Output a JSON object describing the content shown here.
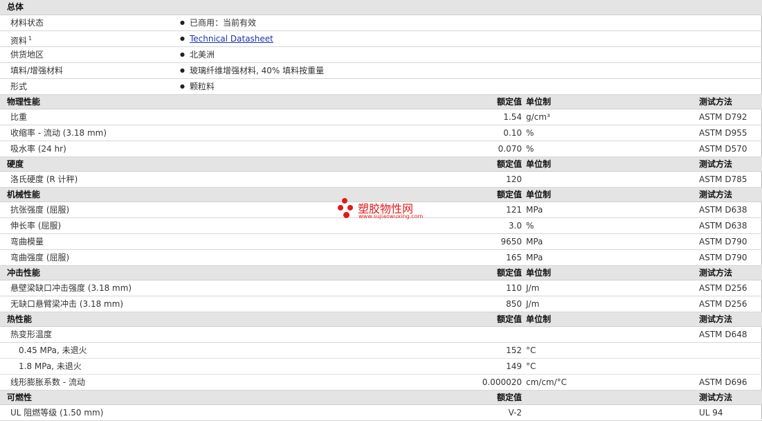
{
  "watermark": {
    "text": "塑胶物性网",
    "url": "www.sujiaowuxing.com",
    "color": "#e01b1b"
  },
  "general": {
    "title": "总体",
    "rows": [
      {
        "label": "材料状态",
        "value": "已商用：当前有效"
      },
      {
        "label": "资料",
        "note": "1",
        "value": "Technical Datasheet",
        "link": true
      },
      {
        "label": "供货地区",
        "value": "北美洲"
      },
      {
        "label": "填料/增强材料",
        "value": "玻璃纤维增强材料, 40% 填料按重量"
      },
      {
        "label": "形式",
        "value": "颗粒料"
      }
    ]
  },
  "sections": [
    {
      "title": "物理性能",
      "h_val": "额定值",
      "h_unit": "单位制",
      "h_test": "测试方法",
      "rows": [
        {
          "label": "比重",
          "value": "1.54",
          "unit": "g/cm³",
          "test": "ASTM D792"
        },
        {
          "label": "收缩率 - 流动  (3.18 mm)",
          "value": "0.10",
          "unit": "%",
          "test": "ASTM D955"
        },
        {
          "label": "吸水率  (24 hr)",
          "value": "0.070",
          "unit": "%",
          "test": "ASTM D570"
        }
      ]
    },
    {
      "title": "硬度",
      "h_val": "额定值",
      "h_unit": "单位制",
      "h_test": "测试方法",
      "rows": [
        {
          "label": "洛氏硬度  (R 计秤)",
          "value": "120",
          "unit": "",
          "test": "ASTM D785"
        }
      ]
    },
    {
      "title": "机械性能",
      "h_val": "额定值",
      "h_unit": "单位制",
      "h_test": "测试方法",
      "rows": [
        {
          "label": "抗张强度  (屈服)",
          "value": "121",
          "unit": "MPa",
          "test": "ASTM D638"
        },
        {
          "label": "伸长率  (屈服)",
          "value": "3.0",
          "unit": "%",
          "test": "ASTM D638"
        },
        {
          "label": "弯曲模量",
          "value": "9650",
          "unit": "MPa",
          "test": "ASTM D790"
        },
        {
          "label": "弯曲强度  (屈服)",
          "value": "165",
          "unit": "MPa",
          "test": "ASTM D790"
        }
      ]
    },
    {
      "title": "冲击性能",
      "h_val": "额定值",
      "h_unit": "单位制",
      "h_test": "测试方法",
      "rows": [
        {
          "label": "悬壁梁缺口冲击强度  (3.18 mm)",
          "value": "110",
          "unit": "J/m",
          "test": "ASTM D256"
        },
        {
          "label": "无缺口悬臂梁冲击  (3.18 mm)",
          "value": "850",
          "unit": "J/m",
          "test": "ASTM D256"
        }
      ]
    },
    {
      "title": "热性能",
      "h_val": "额定值",
      "h_unit": "单位制",
      "h_test": "测试方法",
      "rows": [
        {
          "label": "热变形温度",
          "value": "",
          "unit": "",
          "test": "ASTM D648"
        },
        {
          "label": "0.45 MPa, 未退火",
          "value": "152",
          "unit": "°C",
          "test": "",
          "indent": true
        },
        {
          "label": "1.8 MPa, 未退火",
          "value": "149",
          "unit": "°C",
          "test": "",
          "indent": true
        },
        {
          "label": "线形膨胀系数 - 流动",
          "value": "0.000020",
          "unit": "cm/cm/°C",
          "test": "ASTM D696"
        }
      ]
    },
    {
      "title": "可燃性",
      "h_val": "额定值",
      "h_unit": "",
      "h_test": "测试方法",
      "rows": [
        {
          "label": "UL 阻燃等级  (1.50 mm)",
          "value": "V-2",
          "unit": "",
          "test": "UL 94"
        }
      ]
    }
  ]
}
